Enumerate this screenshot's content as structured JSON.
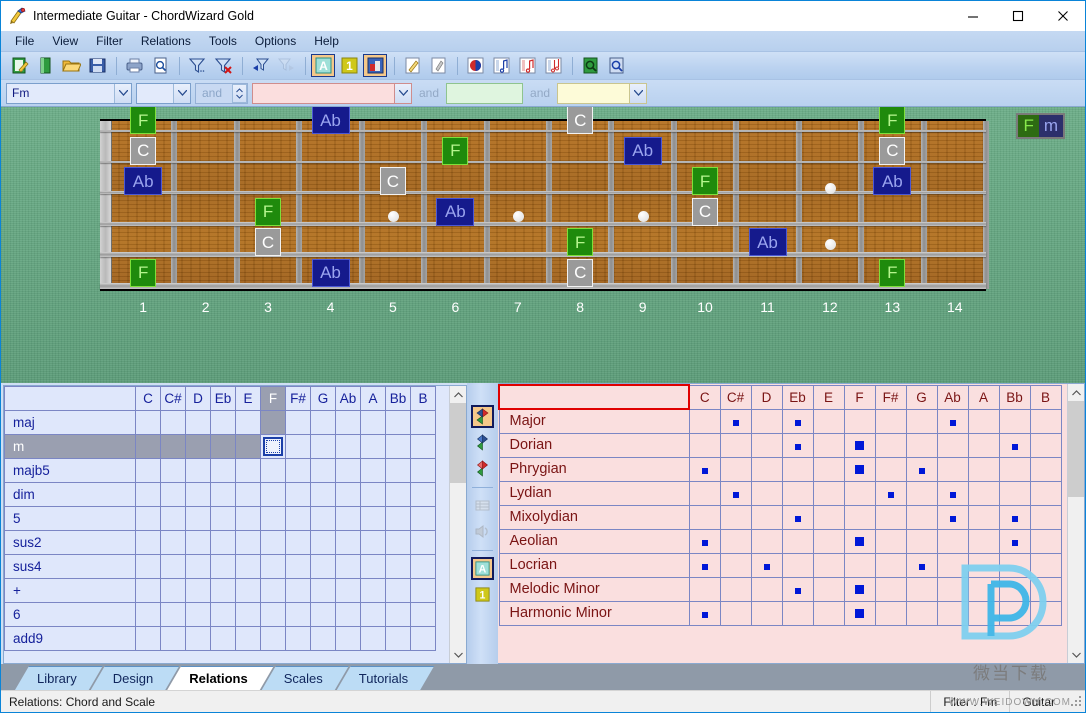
{
  "window": {
    "title": "Intermediate Guitar - ChordWizard Gold",
    "app_icon": "chordwizard-icon",
    "minimize_label": "–",
    "maximize_label": "□",
    "close_label": "×"
  },
  "menu": {
    "items": [
      {
        "label": "File",
        "name": "menu-file"
      },
      {
        "label": "View",
        "name": "menu-view"
      },
      {
        "label": "Filter",
        "name": "menu-filter"
      },
      {
        "label": "Relations",
        "name": "menu-relations"
      },
      {
        "label": "Tools",
        "name": "menu-tools"
      },
      {
        "label": "Options",
        "name": "menu-options"
      },
      {
        "label": "Help",
        "name": "menu-help"
      }
    ]
  },
  "toolbar": {
    "buttons": [
      {
        "name": "new-song-icon",
        "icon": "new-document"
      },
      {
        "name": "new-library-icon",
        "icon": "green-book"
      },
      {
        "name": "open-icon",
        "icon": "open-folder"
      },
      {
        "name": "save-icon",
        "icon": "floppy-disk"
      },
      {
        "name": "print-icon",
        "icon": "printer"
      },
      {
        "name": "print-preview-icon",
        "icon": "page-magnifier"
      },
      {
        "name": "filter-icon",
        "icon": "funnel"
      },
      {
        "name": "clear-filter-icon",
        "icon": "funnel-x"
      },
      {
        "name": "filter-back-icon",
        "icon": "funnel-left-arrow"
      },
      {
        "name": "filter-forward-icon",
        "icon": "funnel-right-arrow"
      },
      {
        "name": "show-names-icon",
        "icon": "letter-a"
      },
      {
        "name": "show-numbers-icon",
        "icon": "number-one"
      },
      {
        "name": "note-colours-icon",
        "icon": "colour-swatch"
      },
      {
        "name": "pencil-icon",
        "icon": "pencil"
      },
      {
        "name": "eraser-icon",
        "icon": "eraser"
      },
      {
        "name": "chord-wheel-icon",
        "icon": "chord-wheel"
      },
      {
        "name": "scale-tool-icon",
        "icon": "note-chart"
      },
      {
        "name": "arpeggio-icon",
        "icon": "note-chart-red"
      },
      {
        "name": "interval-icon",
        "icon": "note-chart-blue"
      },
      {
        "name": "zoom-book-icon",
        "icon": "green-magnifier"
      },
      {
        "name": "zoom-view-icon",
        "icon": "blue-magnifier"
      }
    ]
  },
  "filterbar": {
    "chord_root": {
      "value": "Fm",
      "placeholder": ""
    },
    "chord_second": {
      "value": "",
      "placeholder": ""
    },
    "and_1": "and",
    "scale_filter": {
      "value": "",
      "placeholder": ""
    },
    "and_2": "and",
    "extra_filter": {
      "value": "",
      "placeholder": ""
    },
    "and_3": "and",
    "last_filter": {
      "value": "",
      "placeholder": ""
    }
  },
  "fretboard": {
    "chord_badge": {
      "root": "F",
      "quality": "m"
    },
    "fret_numbers": [
      "1",
      "2",
      "3",
      "4",
      "5",
      "6",
      "7",
      "8",
      "9",
      "10",
      "11",
      "12",
      "13",
      "14"
    ],
    "legend": {
      "root_note": "F",
      "third_note": "Ab",
      "fifth_note": "C"
    },
    "notes": [
      {
        "label": "F",
        "role": "root",
        "string": 1,
        "fret": 1,
        "name": "fret-note-f-s1-f1"
      },
      {
        "label": "Ab",
        "role": "fifth",
        "string": 1,
        "fret": 4,
        "name": "fret-note-ab-s1-f4"
      },
      {
        "label": "C",
        "role": "third",
        "string": 1,
        "fret": 8,
        "name": "fret-note-c-s1-f8"
      },
      {
        "label": "F",
        "role": "root",
        "string": 1,
        "fret": 13,
        "name": "fret-note-f-s1-f13"
      },
      {
        "label": "C",
        "role": "third",
        "string": 2,
        "fret": 1,
        "name": "fret-note-c-s2-f1"
      },
      {
        "label": "F",
        "role": "root",
        "string": 2,
        "fret": 6,
        "name": "fret-note-f-s2-f6"
      },
      {
        "label": "Ab",
        "role": "fifth",
        "string": 2,
        "fret": 9,
        "name": "fret-note-ab-s2-f9"
      },
      {
        "label": "C",
        "role": "third",
        "string": 2,
        "fret": 13,
        "name": "fret-note-c-s2-f13"
      },
      {
        "label": "Ab",
        "role": "fifth",
        "string": 3,
        "fret": 1,
        "name": "fret-note-ab-s3-f1"
      },
      {
        "label": "C",
        "role": "third",
        "string": 3,
        "fret": 5,
        "name": "fret-note-c-s3-f5"
      },
      {
        "label": "F",
        "role": "root",
        "string": 3,
        "fret": 10,
        "name": "fret-note-f-s3-f10"
      },
      {
        "label": "Ab",
        "role": "fifth",
        "string": 3,
        "fret": 13,
        "name": "fret-note-ab-s3-f13"
      },
      {
        "label": "F",
        "role": "root",
        "string": 4,
        "fret": 3,
        "name": "fret-note-f-s4-f3"
      },
      {
        "label": "Ab",
        "role": "fifth",
        "string": 4,
        "fret": 6,
        "name": "fret-note-ab-s4-f6"
      },
      {
        "label": "C",
        "role": "third",
        "string": 4,
        "fret": 10,
        "name": "fret-note-c-s4-f10"
      },
      {
        "label": "C",
        "role": "third",
        "string": 5,
        "fret": 3,
        "name": "fret-note-c-s5-f3"
      },
      {
        "label": "F",
        "role": "root",
        "string": 5,
        "fret": 8,
        "name": "fret-note-f-s5-f8"
      },
      {
        "label": "Ab",
        "role": "fifth",
        "string": 5,
        "fret": 11,
        "name": "fret-note-ab-s5-f11"
      },
      {
        "label": "F",
        "role": "root",
        "string": 6,
        "fret": 1,
        "name": "fret-note-f-s6-f1"
      },
      {
        "label": "Ab",
        "role": "fifth",
        "string": 6,
        "fret": 4,
        "name": "fret-note-ab-s6-f4"
      },
      {
        "label": "C",
        "role": "third",
        "string": 6,
        "fret": 8,
        "name": "fret-note-c-s6-f8"
      },
      {
        "label": "F",
        "role": "root",
        "string": 6,
        "fret": 13,
        "name": "fret-note-f-s6-f13"
      }
    ],
    "inlays": [
      {
        "fret": 3,
        "pos": "mid-upper"
      },
      {
        "fret": 5,
        "pos": "mid"
      },
      {
        "fret": 7,
        "pos": "mid"
      },
      {
        "fret": 9,
        "pos": "mid"
      },
      {
        "fret": 12,
        "pos": "upper"
      },
      {
        "fret": 12,
        "pos": "lower"
      },
      {
        "fret": 13,
        "pos": "upper"
      }
    ]
  },
  "chords_panel": {
    "note_columns": [
      "C",
      "C#",
      "D",
      "Eb",
      "E",
      "F",
      "F#",
      "G",
      "Ab",
      "A",
      "Bb",
      "B"
    ],
    "selected_column": "F",
    "selected_row": "m",
    "rows": [
      "maj",
      "m",
      "majb5",
      "dim",
      "5",
      "sus2",
      "sus4",
      "+",
      "6",
      "add9"
    ],
    "scroll": {
      "up_arrow": "∧",
      "down_arrow": "∨"
    }
  },
  "scales_panel": {
    "header_label": "",
    "note_columns": [
      "C",
      "C#",
      "D",
      "Eb",
      "E",
      "F",
      "F#",
      "G",
      "Ab",
      "A",
      "Bb",
      "B"
    ],
    "rows": [
      {
        "label": "Major",
        "marks": [
          "C#",
          "Eb",
          "Ab"
        ],
        "big": []
      },
      {
        "label": "Dorian",
        "marks": [
          "Eb",
          "F",
          "Bb"
        ],
        "big": [
          "F"
        ]
      },
      {
        "label": "Phrygian",
        "marks": [
          "C",
          "F",
          "G"
        ],
        "big": [
          "F"
        ]
      },
      {
        "label": "Lydian",
        "marks": [
          "C#",
          "F#",
          "Ab"
        ],
        "big": []
      },
      {
        "label": "Mixolydian",
        "marks": [
          "Eb",
          "Ab",
          "Bb"
        ],
        "big": []
      },
      {
        "label": "Aeolian",
        "marks": [
          "C",
          "F",
          "Bb"
        ],
        "big": [
          "F"
        ]
      },
      {
        "label": "Locrian",
        "marks": [
          "C",
          "D",
          "G"
        ],
        "big": []
      },
      {
        "label": "Melodic Minor",
        "marks": [
          "Eb",
          "F"
        ],
        "big": [
          "F"
        ]
      },
      {
        "label": "Harmonic Minor",
        "marks": [
          "C",
          "F"
        ],
        "big": [
          "F"
        ]
      }
    ],
    "rail_buttons": [
      {
        "name": "chord-and-scale-icon",
        "active": true
      },
      {
        "name": "scale-up-icon",
        "active": false
      },
      {
        "name": "scale-down-icon",
        "active": false
      },
      {
        "name": "grid-view-icon",
        "active": false
      },
      {
        "name": "sound-icon",
        "active": false
      },
      {
        "name": "show-names-icon",
        "active": true
      },
      {
        "name": "show-numbers-icon",
        "active": false
      }
    ],
    "scroll": {
      "up_arrow": "∧",
      "down_arrow": "∨"
    }
  },
  "tabs": [
    {
      "label": "Library",
      "active": false,
      "name": "tab-library"
    },
    {
      "label": "Design",
      "active": false,
      "name": "tab-design"
    },
    {
      "label": "Relations",
      "active": true,
      "name": "tab-relations"
    },
    {
      "label": "Scales",
      "active": false,
      "name": "tab-scales"
    },
    {
      "label": "Tutorials",
      "active": false,
      "name": "tab-tutorials"
    }
  ],
  "statusbar": {
    "message": "Relations:  Chord and Scale",
    "filter": "Filter :  Fm",
    "instrument": "Guitar"
  },
  "watermark": {
    "logo": "D",
    "text": "微当下载",
    "sub": "WWW.WEIDOWN.COM"
  },
  "colors": {
    "root": "#1f8a0c",
    "third": "#9a9a9a",
    "fifth": "#151a8c",
    "felt": "#64a681",
    "wood": "#a4641a",
    "chord_grid_bg": "#dfe7fb",
    "scale_grid_bg": "#fadfdf",
    "mark": "#0018d8"
  }
}
